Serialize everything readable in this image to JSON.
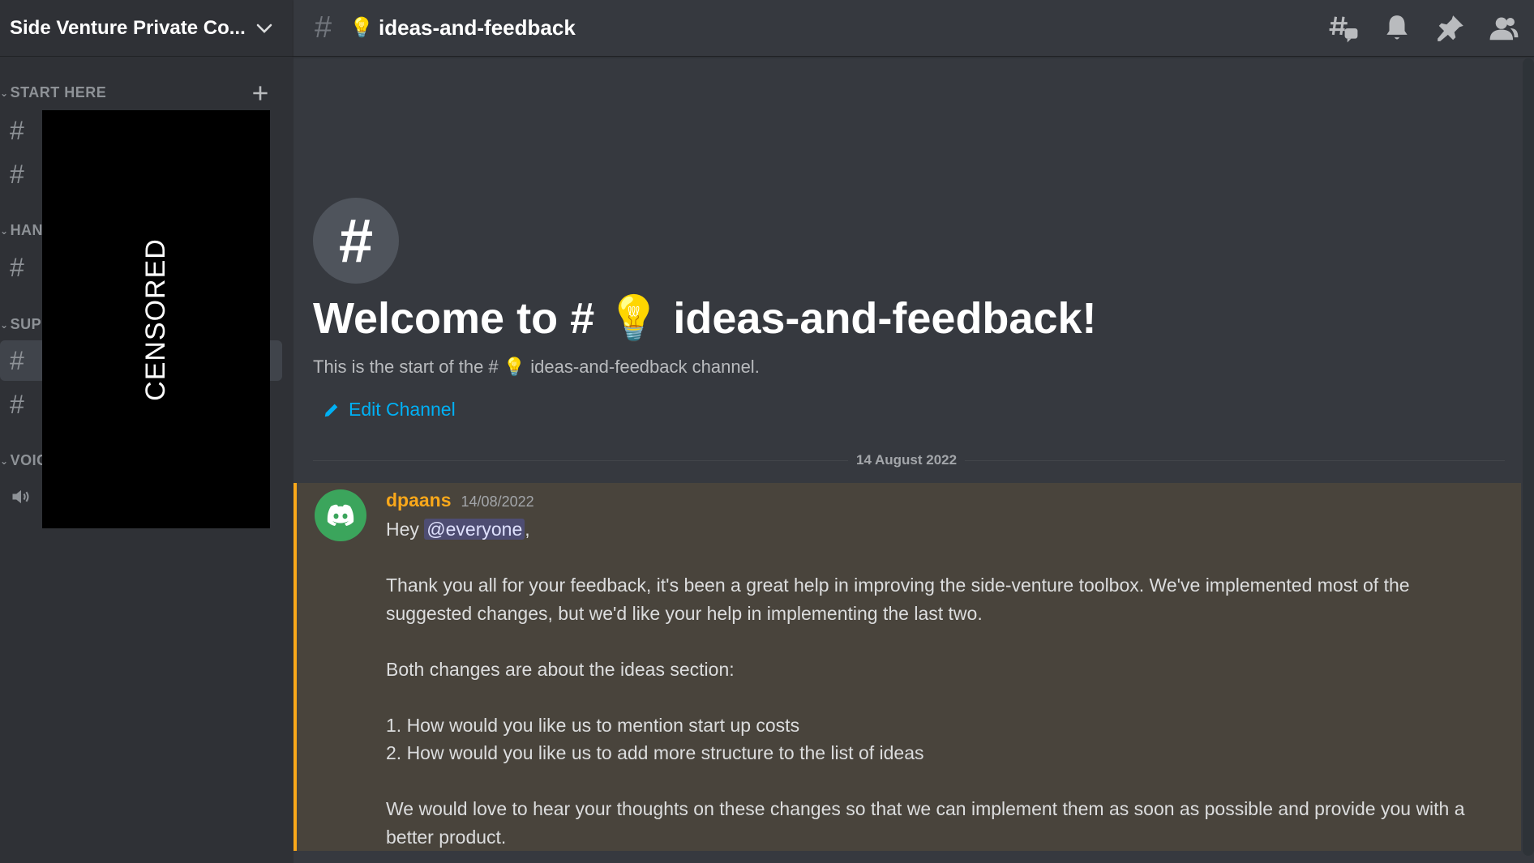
{
  "sidebar": {
    "server_name": "Side Venture Private Co...",
    "categories": [
      {
        "label": "START HERE"
      },
      {
        "label": "HAN"
      },
      {
        "label": "SUPI"
      },
      {
        "label": "VOIC"
      }
    ],
    "censor_label": "CENSORED"
  },
  "header": {
    "channel_emoji": "💡",
    "channel_name": "ideas-and-feedback"
  },
  "welcome": {
    "title": "Welcome to # 💡 ideas-and-feedback!",
    "subtitle": "This is the start of the # 💡 ideas-and-feedback channel.",
    "edit_label": "Edit Channel"
  },
  "date_divider": "14 August 2022",
  "message": {
    "author": "dpaans",
    "timestamp": "14/08/2022",
    "greeting_prefix": "Hey ",
    "mention": "@everyone",
    "greeting_suffix": ",",
    "para1": "Thank you all for your feedback, it's been a great help in improving the side-venture toolbox. We've implemented most of the suggested changes, but we'd like your help in implementing the last two.",
    "para2": "Both changes are about the ideas section:",
    "item1": "1. How would you like us to mention start up costs",
    "item2": "2. How would you like us to add more structure to the list of ideas",
    "para3": "We would love to hear your thoughts on these changes so that we can implement them as soon as possible and provide you with a better product."
  },
  "colors": {
    "accent_author": "#faa81a",
    "link": "#00b0f4",
    "avatar_bg": "#3ba55c"
  }
}
